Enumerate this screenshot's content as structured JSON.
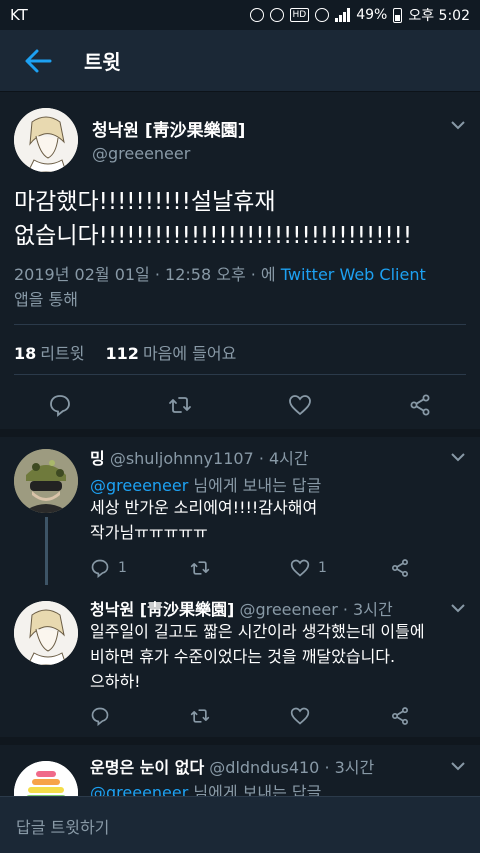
{
  "status_bar": {
    "carrier": "KT",
    "battery": "49%",
    "time": "오후 5:02"
  },
  "app_bar": {
    "title": "트윗"
  },
  "main_tweet": {
    "author_name": "청낙원 [靑沙果樂園]",
    "author_handle": "@greeeneer",
    "text_line1": "마감했다!!!!!!!!!!설날휴재",
    "text_line2": "없습니다!!!!!!!!!!!!!!!!!!!!!!!!!!!!!!!!!!",
    "meta_date": "2019년 02월 01일 · 12:58 오후 · 에 ",
    "meta_client": "Twitter Web Client",
    "meta_suffix": "앱을 통해",
    "retweets_count": "18",
    "retweets_label": "리트윗",
    "likes_count": "112",
    "likes_label": "마음에 들어요"
  },
  "replies": [
    {
      "name": "밍",
      "handle": "@shuljohnny1107",
      "time": "· 4시간",
      "reply_to_handle": "@greeeneer",
      "reply_to_suffix": " 님에게 보내는 답글",
      "text_line1": "세상 반가운 소리에여!!!!감사해여",
      "text_line2": "작가님ㅠㅠㅠㅠㅠ",
      "reply_count": "1",
      "like_count": "1"
    },
    {
      "name": "청낙원 [靑沙果樂園]",
      "handle": "@greeeneer",
      "time": "· 3시간",
      "text_line1": "일주일이 길고도 짧은 시간이라 생각했는데 이틀에",
      "text_line2": "비하면 휴가 수준이었다는 것을 깨달았습니다.",
      "text_line3": "으하하!"
    },
    {
      "name": "운명은 눈이 없다",
      "handle": "@dldndus410",
      "time": "· 3시간",
      "reply_to_handle": "@greeeneer",
      "reply_to_suffix": " 님에게 보내는 답글"
    }
  ],
  "composer": {
    "placeholder": "답글 트윗하기"
  },
  "colors": {
    "background": "#141d26",
    "bar": "#1b2836",
    "accent": "#1da1f2",
    "secondary_text": "#8899a6"
  },
  "icons": [
    "back-arrow-icon",
    "chevron-down-icon",
    "reply-icon",
    "retweet-icon",
    "heart-icon",
    "share-icon"
  ]
}
